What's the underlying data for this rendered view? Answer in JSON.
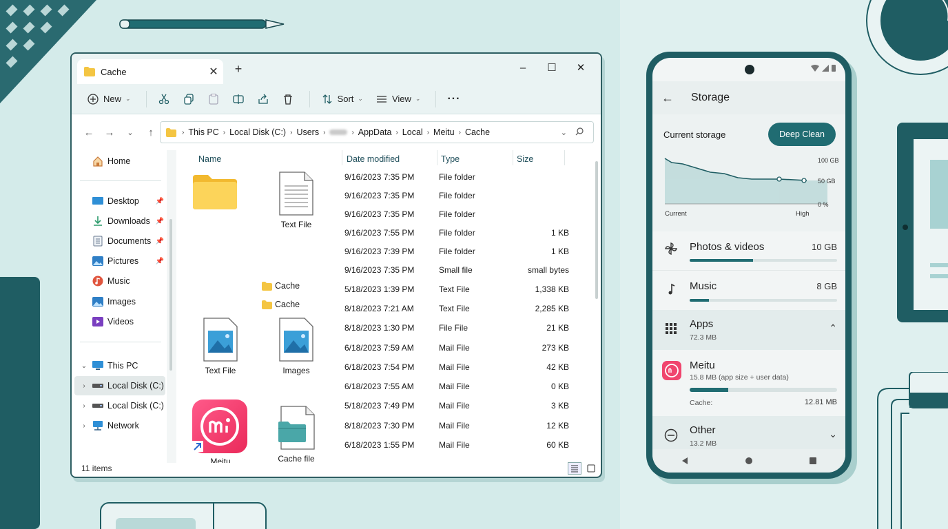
{
  "window": {
    "tab_title": "Cache",
    "toolbar": {
      "new_label": "New",
      "sort_label": "Sort",
      "view_label": "View"
    },
    "breadcrumbs": [
      "This PC",
      "Local Disk (C:)",
      "Users",
      "AppData",
      "Local",
      "Meitu",
      "Cache"
    ],
    "nav": {
      "home": "Home",
      "quick": [
        "Desktop",
        "Downloads",
        "Documents",
        "Pictures",
        "Music",
        "Images",
        "Videos"
      ],
      "this_pc": "This PC",
      "disk1": "Local Disk (C:)",
      "disk2": "Local Disk (C:)",
      "network": "Network"
    },
    "columns": {
      "name": "Name",
      "date": "Date modified",
      "type": "Type",
      "size": "Size"
    },
    "icons": {
      "text_file_1": "Text File",
      "cache_folder_1": "Cache",
      "cache_folder_2": "Cache",
      "text_file_2": "Text File",
      "images": "Images",
      "meitu": "Meitu",
      "cache_file": "Cache file"
    },
    "rows": [
      {
        "date": "9/16/2023 7:35 PM",
        "type": "File folder",
        "size": ""
      },
      {
        "date": "9/16/2023 7:35 PM",
        "type": "File folder",
        "size": ""
      },
      {
        "date": "9/16/2023 7:35 PM",
        "type": "File folder",
        "size": ""
      },
      {
        "date": "9/16/2023 7:55 PM",
        "type": "File folder",
        "size": "1 KB"
      },
      {
        "date": "9/16/2023 7:39 PM",
        "type": "File folder",
        "size": "1 KB"
      },
      {
        "date": "9/16/2023 7:35 PM",
        "type": "Small file",
        "size": "small bytes"
      },
      {
        "date": "5/18/2023 1:39 PM",
        "type": "Text File",
        "size": "1,338 KB"
      },
      {
        "date": "8/18/2023 7:21 AM",
        "type": "Text File",
        "size": "2,285 KB"
      },
      {
        "date": "8/18/2023 1:30 PM",
        "type": "File File",
        "size": "21 KB"
      },
      {
        "date": "6/18/2023 7:59 AM",
        "type": "Mail File",
        "size": "273 KB"
      },
      {
        "date": "6/18/2023 7:54 PM",
        "type": "Mail File",
        "size": "42 KB"
      },
      {
        "date": "6/18/2023 7:55 AM",
        "type": "Mail File",
        "size": "0 KB"
      },
      {
        "date": "5/18/2023 7:49 PM",
        "type": "Mail File",
        "size": "3 KB"
      },
      {
        "date": "8/18/2023 7:30 PM",
        "type": "Mail File",
        "size": "12 KB"
      },
      {
        "date": "6/18/2023 1:55 PM",
        "type": "Mail File",
        "size": "60 KB"
      }
    ],
    "status": "11 items"
  },
  "phone": {
    "title": "Storage",
    "current_storage": "Current storage",
    "deep_clean": "Deep Clean",
    "chart_labels": {
      "y_top": "100 GB",
      "y_mid": "50 GB",
      "y_bot": "0 %",
      "x_left": "Current",
      "x_right": "High"
    },
    "photos": {
      "name": "Photos & videos",
      "value": "10 GB",
      "fill": 0.43
    },
    "music": {
      "name": "Music",
      "value": "8 GB",
      "fill": 0.13
    },
    "apps": {
      "name": "Apps",
      "sub": "72.3 MB"
    },
    "meitu": {
      "name": "Meitu",
      "sub": "15.8 MB (app size + user data)",
      "cache_label": "Cache:",
      "cache_value": "12.81 MB",
      "fill": 0.26
    },
    "other": {
      "name": "Other",
      "sub": "13.2 MB"
    }
  },
  "colors": {
    "accent": "#206c72",
    "background": "#d4ebea"
  }
}
